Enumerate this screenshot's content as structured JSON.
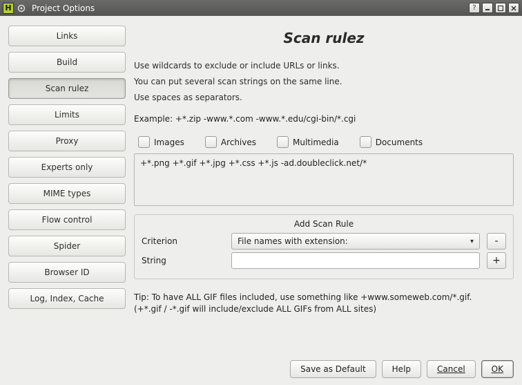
{
  "titlebar": {
    "app_initial": "H",
    "title": "Project Options"
  },
  "sidebar": {
    "items": [
      {
        "label": "Links",
        "selected": false
      },
      {
        "label": "Build",
        "selected": false
      },
      {
        "label": "Scan rulez",
        "selected": true
      },
      {
        "label": "Limits",
        "selected": false
      },
      {
        "label": "Proxy",
        "selected": false
      },
      {
        "label": "Experts only",
        "selected": false
      },
      {
        "label": "MIME types",
        "selected": false
      },
      {
        "label": "Flow control",
        "selected": false
      },
      {
        "label": "Spider",
        "selected": false
      },
      {
        "label": "Browser ID",
        "selected": false
      },
      {
        "label": "Log, Index, Cache",
        "selected": false
      }
    ]
  },
  "main": {
    "title": "Scan rulez",
    "desc_line1": "Use wildcards to exclude or include URLs or links.",
    "desc_line2": "You can put several scan strings on the same line.",
    "desc_line3": "Use spaces as separators.",
    "example": "Example: +*.zip -www.*.com -www.*.edu/cgi-bin/*.cgi",
    "checks": {
      "images": "Images",
      "archives": "Archives",
      "multimedia": "Multimedia",
      "documents": "Documents"
    },
    "rules_value": "+*.png +*.gif +*.jpg +*.css +*.js -ad.doubleclick.net/*",
    "group_title": "Add Scan Rule",
    "criterion_label": "Criterion",
    "criterion_value": "File names with extension:",
    "string_label": "String",
    "string_value": "",
    "minus_label": "-",
    "plus_label": "+",
    "tip_line1": "Tip: To have ALL GIF files included, use something like +www.someweb.com/*.gif.",
    "tip_line2": "(+*.gif / -*.gif will include/exclude ALL GIFs from ALL sites)"
  },
  "footer": {
    "save_default": "Save as Default",
    "help": "Help",
    "cancel": "Cancel",
    "ok": "OK"
  }
}
